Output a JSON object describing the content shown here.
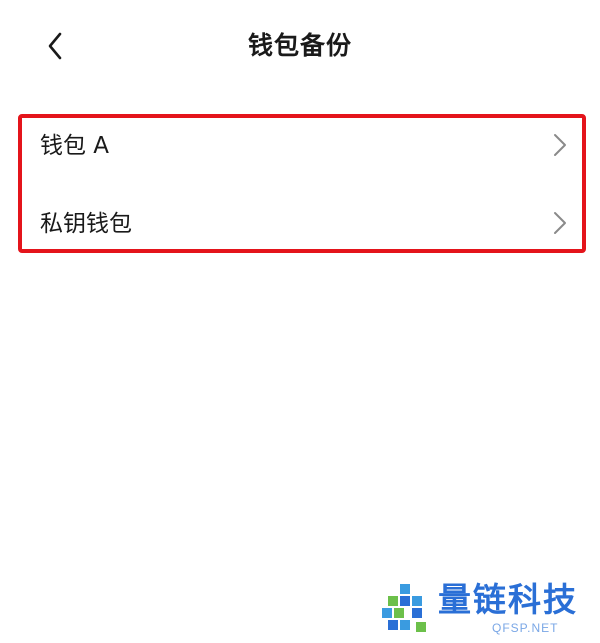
{
  "header": {
    "title": "钱包备份",
    "back_icon": "chevron-left-icon"
  },
  "wallet_list": {
    "items": [
      {
        "label": "钱包 A",
        "icon": "chevron-right-icon"
      },
      {
        "label": "私钥钱包",
        "icon": "chevron-right-icon"
      }
    ],
    "highlight_color": "#e4141b"
  },
  "watermark": {
    "text": "量链科技",
    "sub": "QFSP.NET",
    "color": "#2a6fd6"
  }
}
